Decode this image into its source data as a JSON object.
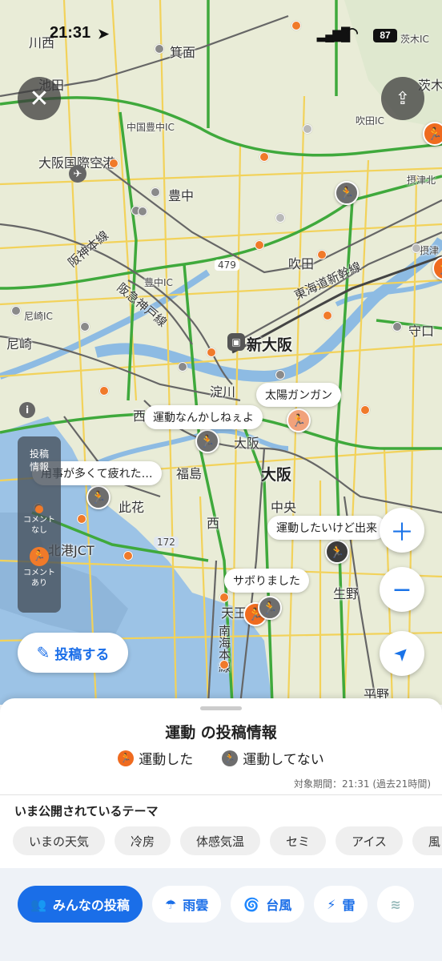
{
  "status_bar": {
    "time": "21:31",
    "battery": "87"
  },
  "map": {
    "places": {
      "kawanishi": "川西",
      "minoo": "箕面",
      "ikeda": "池田",
      "ibaraki": "茨木",
      "ibaraki_ic": "茨木IC",
      "chugoku_toyonaka_ic": "中国豊中IC",
      "suita_ic": "吹田IC",
      "itami_airport": "大阪国際空港",
      "toyonaka": "豊中",
      "settsu_kita": "摂津北",
      "settsu": "摂津",
      "route_479": "479",
      "suita": "吹田",
      "toyonaka_ic": "豊中IC",
      "amagasaki_ic": "尼崎IC",
      "amagasaki": "尼崎",
      "shin_osaka": "新大阪",
      "moriguchi": "守口",
      "yodogawa": "淀川",
      "nishi_yodogawa": "西",
      "kita_osaka": "大阪",
      "fukushima": "福島",
      "osaka": "大阪",
      "konohana": "此花",
      "chuo": "中央",
      "nishi": "西",
      "route_172": "172",
      "hokko_jct": "北港JCT",
      "tennoji": "天王",
      "ikuno": "生野",
      "hirano": "平野"
    },
    "rail_labels": {
      "hanshin_line": "阪神本線",
      "hankyu_kobe": "阪急神戸線",
      "tokaido_shinkansen": "東海道新幹線",
      "nankai_line": "南海本線"
    },
    "bubbles": {
      "b1": "太陽ガンガン",
      "b2": "運動なんかしねぇよ",
      "b3": "用事が多くて疲れた…",
      "b4": "運動したいけど出来",
      "b5": "サボりました"
    },
    "post_panel": {
      "title": "投稿\n情報",
      "no_comment": "コメント\nなし",
      "with_comment": "コメント\nあり"
    },
    "post_button": "投稿する"
  },
  "sheet": {
    "title": "運動 の投稿情報",
    "legend": [
      {
        "label": "運動した",
        "color": "#ef6b1f"
      },
      {
        "label": "運動してない",
        "color": "#6e6e6e"
      }
    ],
    "period": "対象期間：21:31 (過去21時間)",
    "themes_title": "いま公開されているテーマ",
    "themes": [
      "いまの天気",
      "冷房",
      "体感気温",
      "セミ",
      "アイス",
      "風"
    ],
    "tabs": [
      {
        "label": "みんなの投稿",
        "icon": "people-icon"
      },
      {
        "label": "雨雲",
        "icon": "rain-cloud-icon"
      },
      {
        "label": "台風",
        "icon": "typhoon-icon"
      },
      {
        "label": "雷",
        "icon": "lightning-icon"
      },
      {
        "label": "",
        "icon": "wind-icon"
      }
    ]
  }
}
